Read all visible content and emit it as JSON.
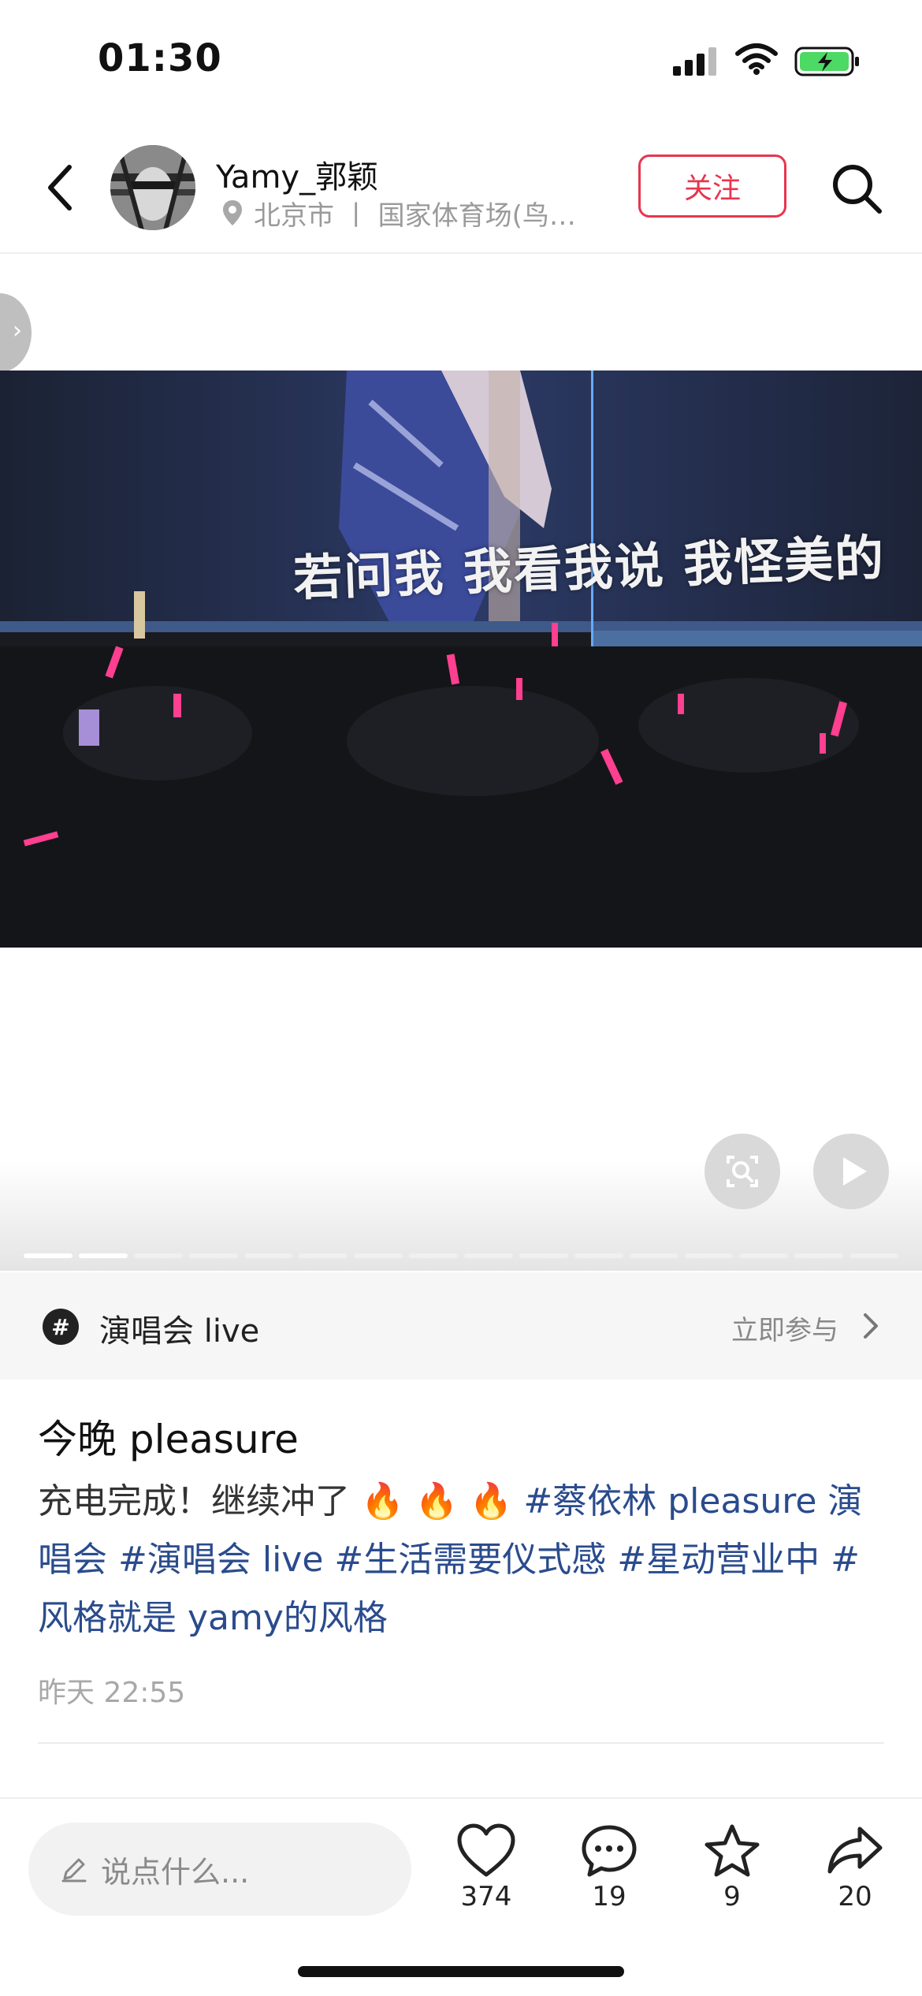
{
  "status_bar": {
    "time": "01:30"
  },
  "header": {
    "user_name": "Yamy_郭颖",
    "location": "北京市 丨 国家体育场(鸟…",
    "follow_label": "关注"
  },
  "media": {
    "lyric_text": "若问我 我看我说 我怪美的",
    "page_count": 16,
    "current_page": 2
  },
  "topic": {
    "name": "演唱会 live",
    "join_label": "立即参与"
  },
  "post": {
    "title": "今晚 pleasure",
    "body_text": "充电完成！继续冲了",
    "emoji": [
      "🔥",
      "🔥",
      "🔥"
    ],
    "tags": [
      "#蔡依林 pleasure 演唱会",
      "#演唱会 live",
      "#生活需要仪式感",
      "#星动营业中",
      "#风格就是 yamy的风格"
    ],
    "time": "昨天 22:55"
  },
  "bottom_bar": {
    "comment_placeholder": "说点什么...",
    "likes": "374",
    "comments": "19",
    "favorites": "9",
    "shares": "20"
  },
  "icons": [
    "back-icon",
    "location-pin-icon",
    "search-icon",
    "scan-icon",
    "play-icon",
    "topic-hash-icon",
    "chevron-right-icon",
    "pencil-icon",
    "heart-icon",
    "comment-icon",
    "star-icon",
    "share-icon"
  ],
  "colors": {
    "accent": "#e8354f",
    "tag": "#2a4b8d"
  }
}
